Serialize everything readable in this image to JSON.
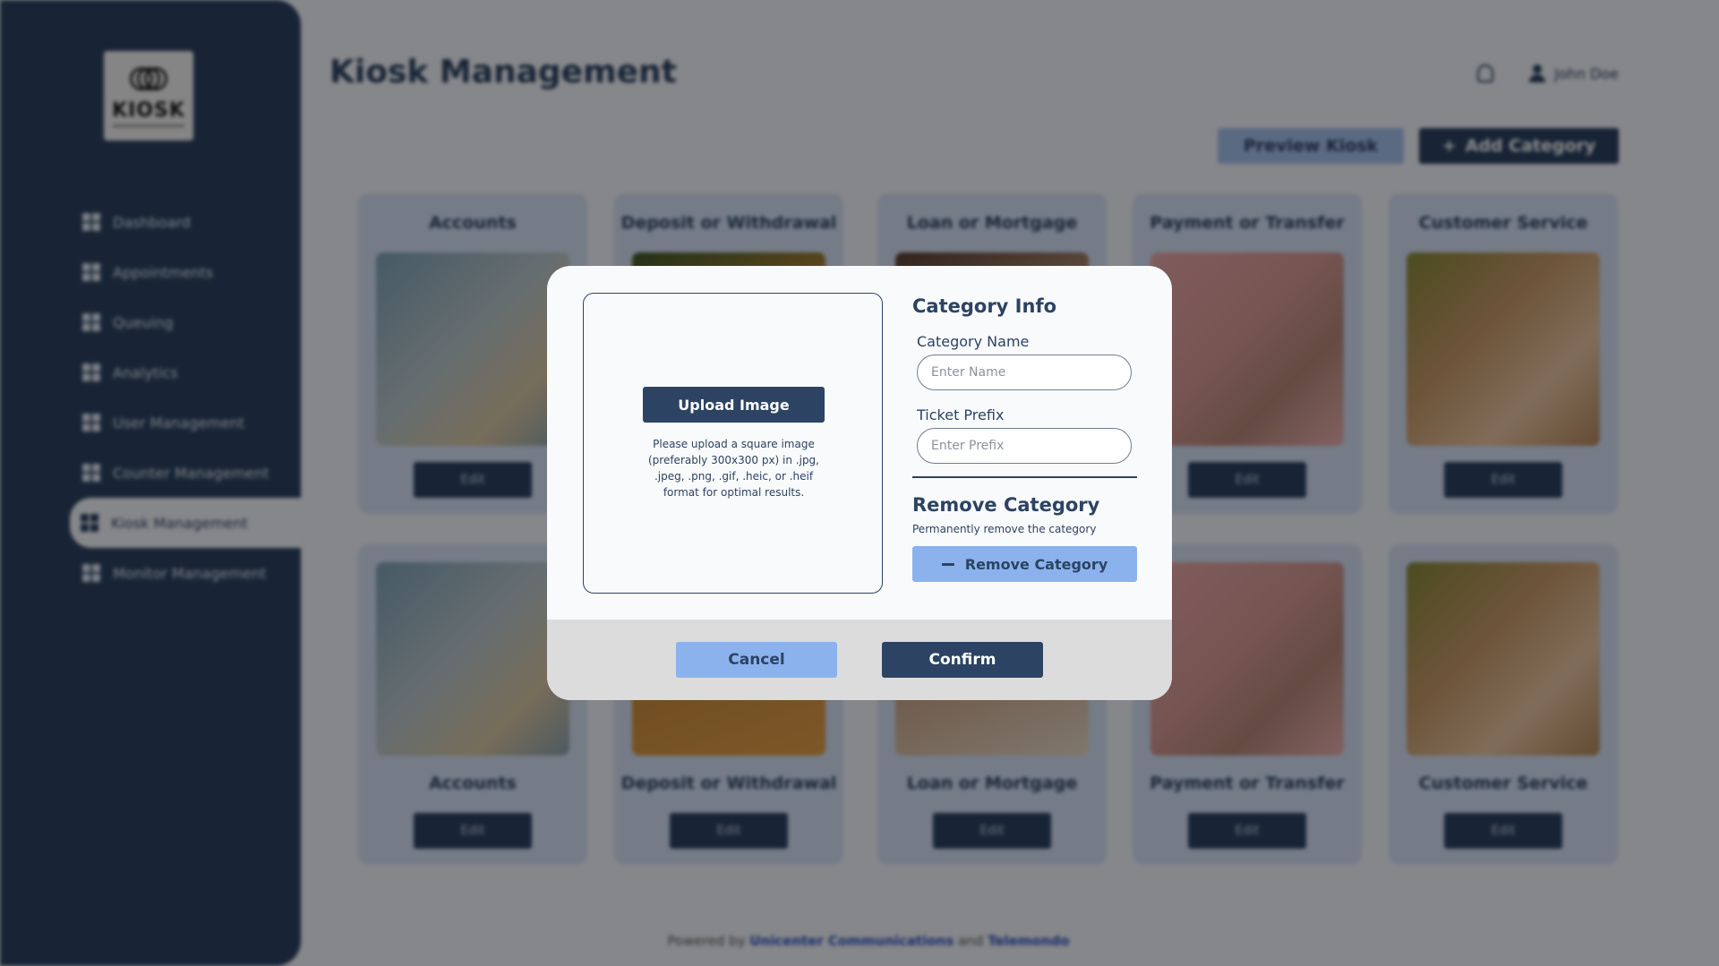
{
  "app": {
    "logo_text": "KIOSK",
    "page_title": "Kiosk Management",
    "user_name": "John Doe"
  },
  "sidebar": {
    "items": [
      {
        "label": "Dashboard"
      },
      {
        "label": "Appointments"
      },
      {
        "label": "Queuing"
      },
      {
        "label": "Analytics"
      },
      {
        "label": "User Management"
      },
      {
        "label": "Counter Management"
      },
      {
        "label": "Kiosk Management",
        "active": true
      },
      {
        "label": "Monitor Management"
      }
    ]
  },
  "toolbar": {
    "preview_label": "Preview Kiosk",
    "add_label": "Add Category",
    "add_icon": "+"
  },
  "categories": [
    {
      "title": "Accounts",
      "edit": "Edit"
    },
    {
      "title": "Deposit or Withdrawal",
      "edit": "Edit"
    },
    {
      "title": "Loan or Mortgage",
      "edit": "Edit"
    },
    {
      "title": "Payment or Transfer",
      "edit": "Edit"
    },
    {
      "title": "Customer Service",
      "edit": "Edit"
    }
  ],
  "footer": {
    "prefix": "Powered by",
    "company1": "Unicenter Communications",
    "joiner": "and",
    "company2": "Telemondo"
  },
  "modal": {
    "upload_button": "Upload Image",
    "upload_help": "Please upload a square image (preferably 300x300 px) in .jpg, .jpeg, .png, .gif, .heic, or .heif format for optimal results.",
    "info_title": "Category Info",
    "name_label": "Category Name",
    "name_placeholder": "Enter Name",
    "prefix_label": "Ticket Prefix",
    "prefix_placeholder": "Enter Prefix",
    "remove_title": "Remove Category",
    "remove_sub": "Permanently remove the category",
    "remove_button": "Remove Category",
    "cancel": "Cancel",
    "confirm": "Confirm"
  },
  "colors": {
    "primary": "#2c4363",
    "accent_light": "#8bb2ec",
    "card_bg": "#d5e2f6",
    "link": "#2a52c4"
  }
}
